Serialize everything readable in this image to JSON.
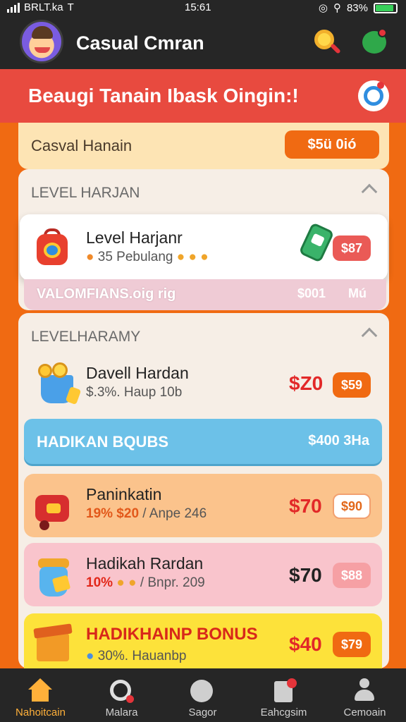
{
  "status_bar": {
    "carrier": "BRLT.ka",
    "network_glyph": "T",
    "time": "15:61",
    "battery_text": "83%",
    "battery_level": 0.83
  },
  "header": {
    "title": "Casual Cmran",
    "icons": [
      "search-icon",
      "chat-icon"
    ]
  },
  "banner": {
    "text": "Beaugi Tanain Ibask Oingin:!"
  },
  "offer": {
    "label": "Casval Hanain",
    "price_button": "$5ü 0ió"
  },
  "section_1": {
    "title": "LEVEL HARJAN",
    "item": {
      "title": "Level Harjanr",
      "subtitle": "35 Pebulang",
      "price_button": "$87"
    },
    "strip": {
      "text": "VALOMFIANS.oig rig",
      "val1": "$001",
      "val2": "Mú"
    }
  },
  "section_2": {
    "title": "LEVELHARAMY",
    "daily": {
      "title": "Davell Hardan",
      "subtitle": "$.3%. Haup 10b",
      "price": "$Z0",
      "price_button": "$59"
    },
    "bonus_bar": {
      "label": "HADIKAN BQUBS",
      "value": "$400 3Ha"
    },
    "rows": [
      {
        "title": "Paninkatin",
        "highlight": "19% $20",
        "subtitle": "/ Anpe 246",
        "price": "$70",
        "price_button": "$90"
      },
      {
        "title": "Hadikah Rardan",
        "highlight": "10%",
        "subtitle": "/ Bnpr. 209",
        "price": "$70",
        "price_button": "$88"
      },
      {
        "title": "HADIKHAINP BONUS",
        "subtitle": "30%. Hauanbp",
        "price": "$40",
        "price_button": "$79"
      }
    ]
  },
  "tabbar": {
    "tabs": [
      {
        "label": "Nahoitcain",
        "icon": "home-icon"
      },
      {
        "label": "Malara",
        "icon": "search-icon"
      },
      {
        "label": "Sagor",
        "icon": "face-icon"
      },
      {
        "label": "Eahcgsim",
        "icon": "document-icon"
      },
      {
        "label": "Cemoain",
        "icon": "person-icon"
      }
    ]
  },
  "colors": {
    "accent": "#f06a12",
    "banner": "#e84a3f",
    "dark": "#262626",
    "price_red": "#e22828"
  }
}
